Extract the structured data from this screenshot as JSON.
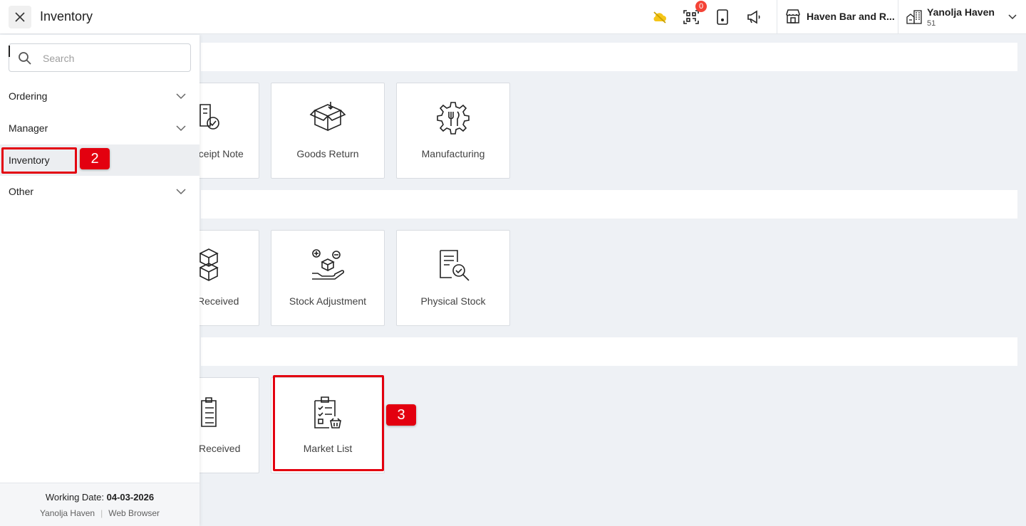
{
  "header": {
    "title": "Inventory",
    "notification_count": "0",
    "outlet_name": "Haven Bar and R...",
    "profile": {
      "name": "Yanolja Haven",
      "sub": "51"
    }
  },
  "sidebar": {
    "search_placeholder": "Search",
    "items": [
      {
        "label": "Ordering",
        "expandable": true
      },
      {
        "label": "Manager",
        "expandable": true
      },
      {
        "label": "Inventory",
        "active": true
      },
      {
        "label": "Other",
        "expandable": true
      }
    ],
    "footer": {
      "working_date_label": "Working Date:",
      "working_date": "04-03-2026",
      "user": "Yanolja Haven",
      "platform": "Web Browser"
    }
  },
  "cards": {
    "row1": [
      "eceipt Note",
      "Goods Return",
      "Manufacturing"
    ],
    "row2": [
      "Received",
      "Stock Adjustment",
      "Physical Stock"
    ],
    "row3": [
      "Received",
      "Market List"
    ]
  },
  "annotations": {
    "step2": "2",
    "step3": "3"
  },
  "colors": {
    "highlight": "#e3000f",
    "cloud_icon": "#f5c518",
    "badge": "#f44336"
  }
}
